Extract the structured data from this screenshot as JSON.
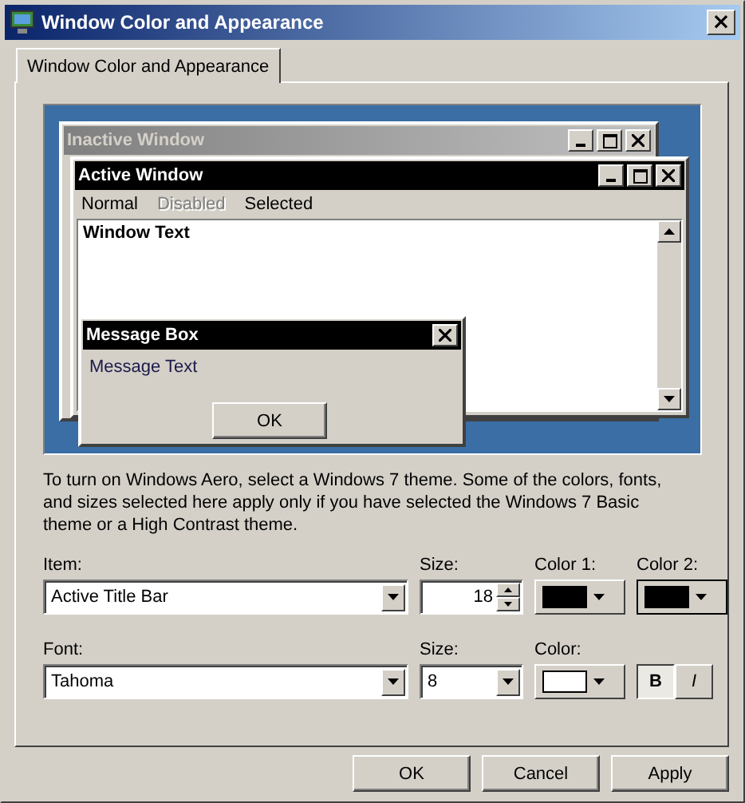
{
  "window": {
    "title": "Window Color and Appearance",
    "close": "×"
  },
  "tabs": [
    {
      "label": "Window Color and Appearance",
      "selected": true
    }
  ],
  "preview": {
    "inactive_window": {
      "title": "Inactive Window"
    },
    "active_window": {
      "title": "Active Window",
      "menu": [
        {
          "label": "Normal",
          "disabled": false
        },
        {
          "label": "Disabled",
          "disabled": true
        },
        {
          "label": "Selected",
          "disabled": false
        }
      ],
      "text": "Window Text"
    },
    "message_box": {
      "title": "Message Box",
      "text": "Message Text",
      "button": "OK"
    }
  },
  "description": "To turn on Windows Aero, select a Windows 7 theme.  Some of the colors, fonts, and sizes selected here apply only if you have selected the Windows 7 Basic theme or a High Contrast theme.",
  "item": {
    "label": "Item:",
    "value": "Active Title Bar"
  },
  "item_size": {
    "label": "Size:",
    "value": "18"
  },
  "color_1": {
    "label": "Color 1:",
    "color": "#000000",
    "focused": false
  },
  "color_2": {
    "label": "Color 2:",
    "color": "#000000",
    "focused": true
  },
  "font": {
    "label": "Font:",
    "value": "Tahoma"
  },
  "font_size": {
    "label": "Size:",
    "value": "8"
  },
  "font_color": {
    "label": "Color:",
    "color": "#ffffff",
    "focused": false
  },
  "style_buttons": [
    {
      "label": "B",
      "kind": "bold",
      "selected": true
    },
    {
      "label": "I",
      "kind": "italic",
      "selected": false
    }
  ],
  "buttons": [
    "OK",
    "Cancel",
    "Apply"
  ]
}
